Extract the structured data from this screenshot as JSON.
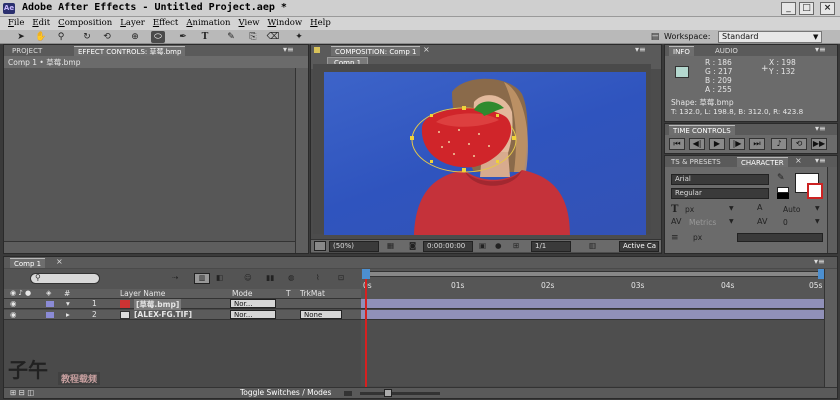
{
  "window": {
    "app_icon": "Ae",
    "title": "Adobe After Effects - Untitled Project.aep *",
    "minimize": "_",
    "maximize": "□",
    "close": "×"
  },
  "menu": [
    "File",
    "Edit",
    "Composition",
    "Layer",
    "Effect",
    "Animation",
    "View",
    "Window",
    "Help"
  ],
  "toolbar": {
    "workspace_label": "Workspace:",
    "workspace_value": "Standard"
  },
  "project_panel": {
    "tabs": [
      "PROJECT",
      "EFFECT CONTROLS: 草莓.bmp"
    ],
    "breadcrumb": "Comp 1 • 草莓.bmp"
  },
  "comp_panel": {
    "tab": "COMPOSITION: Comp 1",
    "subtab": "Comp 1",
    "zoom": "(50%)",
    "timecode": "0:00:00:00",
    "resolution": "1/1",
    "active_camera": "Active Ca"
  },
  "info_panel": {
    "tabs": [
      "INFO",
      "AUDIO"
    ],
    "r": "R : 186",
    "g": "G : 217",
    "b": "B : 209",
    "a": "A : 255",
    "x": "X : 198",
    "y": "Y : 132",
    "shape": "Shape: 草莓.bmp",
    "bounds": "T: 132.0, L: 198.8, B: 312.0, R: 423.8",
    "swatch_color": "#b4d8cf"
  },
  "time_controls": {
    "tab": "TIME CONTROLS"
  },
  "character_panel": {
    "tabs": [
      "TS & PRESETS",
      "CHARACTER"
    ],
    "font": "Arial",
    "style": "Regular",
    "size_unit": "px",
    "leading": "Auto",
    "kerning": "Metrics",
    "tracking": "0",
    "stroke_unit": "px"
  },
  "timeline": {
    "tab": "Comp 1",
    "search_placeholder": "",
    "headers": {
      "num": "#",
      "layer_name": "Layer Name",
      "mode": "Mode",
      "t": "T",
      "trkmat": "TrkMat"
    },
    "layers": [
      {
        "num": "1",
        "name": "[草莓.bmp]",
        "mode": "Nor...",
        "trkmat": "",
        "color": "#8b8bd6"
      },
      {
        "num": "2",
        "name": "[ALEX-FG.TIF]",
        "mode": "Nor...",
        "trkmat": "None",
        "color": "#8b8bd6"
      }
    ],
    "ruler": [
      "0s",
      "01s",
      "02s",
      "03s",
      "04s",
      "05s"
    ],
    "toggle_label": "Toggle Switches / Modes"
  },
  "watermark": {
    "text": "子午",
    "sub": "教程载频"
  }
}
